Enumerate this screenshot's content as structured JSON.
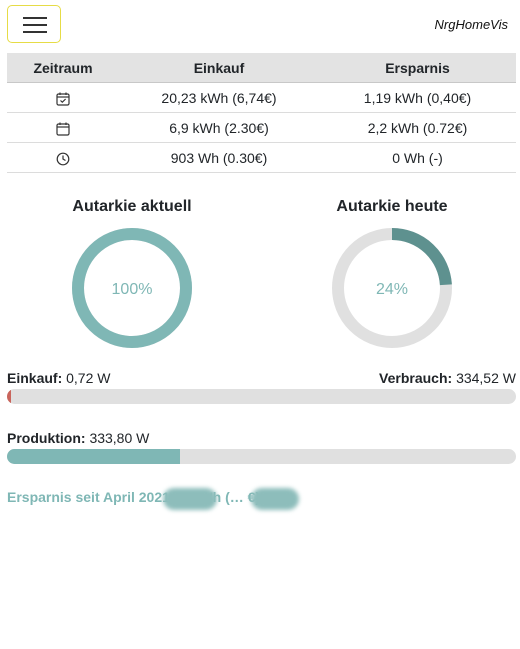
{
  "app": {
    "title": "NrgHomeVis",
    "menu_icon": "hamburger-icon"
  },
  "table": {
    "headers": [
      "Zeitraum",
      "Einkauf",
      "Ersparnis"
    ],
    "rows": [
      {
        "icon": "calendar-check-icon",
        "einkauf": "20,23 kWh (6,74€)",
        "ersparnis": "1,19 kWh (0,40€)"
      },
      {
        "icon": "calendar-icon",
        "einkauf": "6,9 kWh (2.30€)",
        "ersparnis": "2,2 kWh (0.72€)"
      },
      {
        "icon": "clock-icon",
        "einkauf": "903 Wh (0.30€)",
        "ersparnis": "0 Wh (-)"
      }
    ]
  },
  "gauges": [
    {
      "title": "Autarkie aktuell",
      "value_label": "100%",
      "fraction": 1.0
    },
    {
      "title": "Autarkie heute",
      "value_label": "24%",
      "fraction": 0.24
    }
  ],
  "einkauf": {
    "label": "Einkauf:",
    "value": "0,72 W",
    "fraction": 0.006
  },
  "verbrauch": {
    "label": "Verbrauch:",
    "value": "334,52 W"
  },
  "produktion": {
    "label": "Produktion:",
    "value": "333,80 W",
    "fraction": 0.34
  },
  "savings": {
    "text": "Ersparnis seit April 2021 … kWh (… €)"
  },
  "colors": {
    "accent": "#7fb7b5",
    "accent_dark": "#5e918f",
    "track": "#e0e0e0",
    "einkauf_bar": "#c9655c",
    "menu_border": "#e6dc46"
  }
}
